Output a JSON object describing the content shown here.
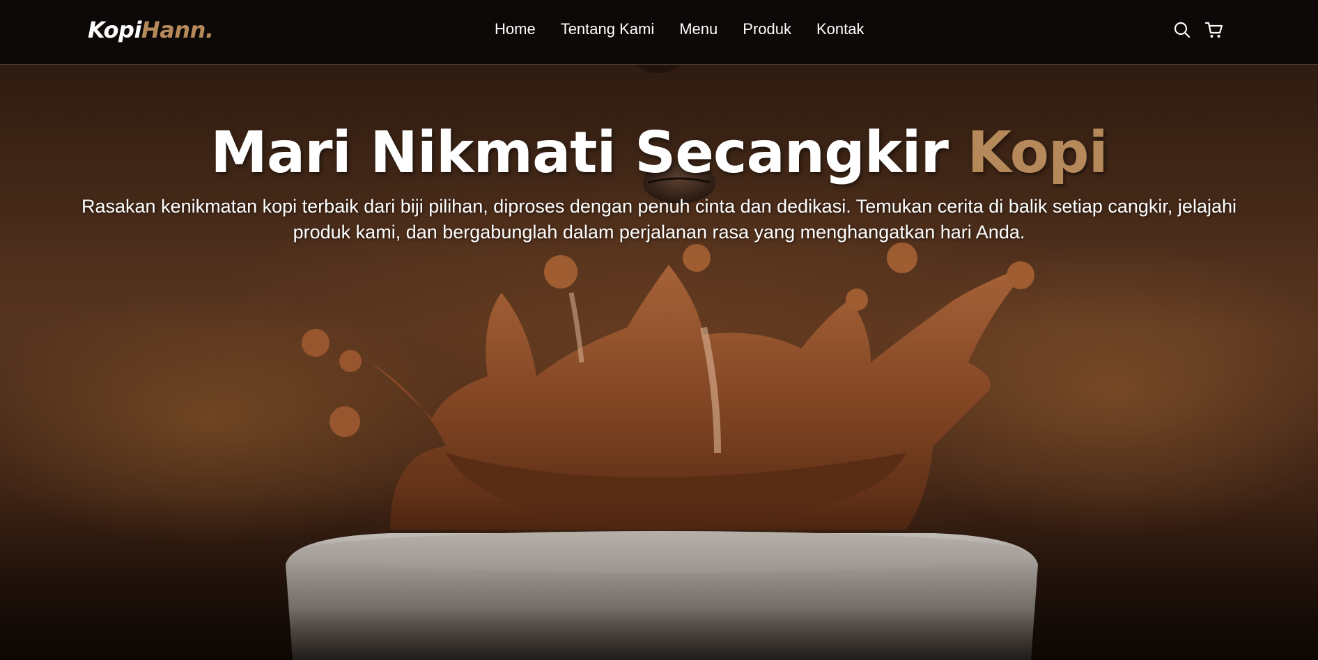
{
  "navbar": {
    "logo_main": "Kopi",
    "logo_accent": "Hann.",
    "links": [
      "Home",
      "Tentang Kami",
      "Menu",
      "Produk",
      "Kontak"
    ],
    "icons": [
      "search-icon",
      "cart-icon"
    ]
  },
  "hero": {
    "title_main": "Mari Nikmati Secangkir",
    "title_accent": "Kopi",
    "description": "Rasakan kenikmatan kopi terbaik dari biji pilihan, diproses dengan penuh cinta dan dedikasi. Temukan cerita di balik setiap cangkir, jelajahi produk kami, dan bergabunglah dalam perjalanan rasa yang menghangatkan hari Anda."
  },
  "colors": {
    "accent": "#b6895b",
    "navbar_bg": "#0a0807",
    "text": "#ffffff"
  }
}
